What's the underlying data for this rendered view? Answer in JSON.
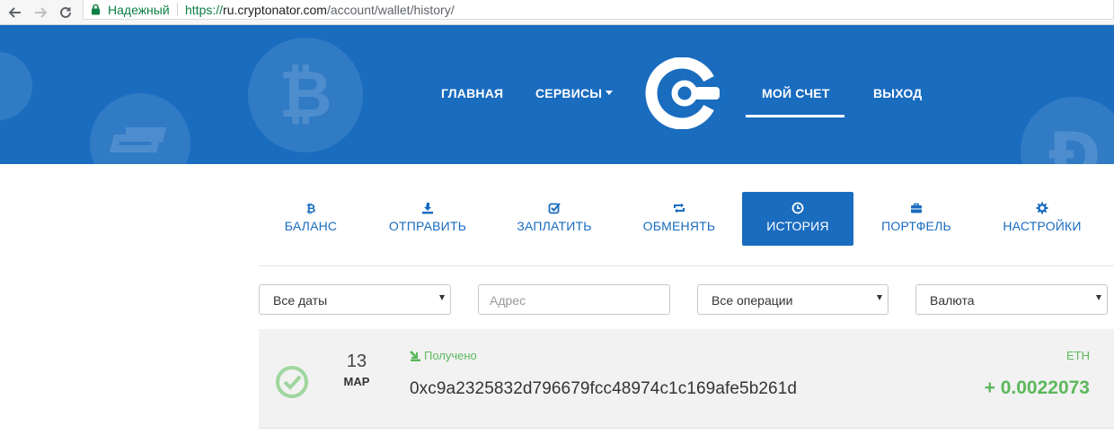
{
  "browser": {
    "secure_label": "Надежный",
    "url_scheme": "https://",
    "url_host": "ru.cryptonator.com",
    "url_path": "/account/wallet/history/"
  },
  "header": {
    "nav": [
      {
        "label": "ГЛАВНАЯ"
      },
      {
        "label": "СЕРВИСЫ"
      },
      {
        "label": "МОЙ СЧЕТ"
      },
      {
        "label": "ВЫХОД"
      }
    ],
    "active_nav": "МОЙ СЧЕТ",
    "colors": {
      "brand": "#1a6cbf",
      "text": "#ffffff"
    }
  },
  "tabs": [
    {
      "label": "БАЛАНС",
      "icon": "bitcoin-icon"
    },
    {
      "label": "ОТПРАВИТЬ",
      "icon": "send-icon"
    },
    {
      "label": "ЗАПЛАТИТЬ",
      "icon": "checkbox-icon"
    },
    {
      "label": "ОБМЕНЯТЬ",
      "icon": "exchange-icon"
    },
    {
      "label": "ИСТОРИЯ",
      "icon": "clock-icon"
    },
    {
      "label": "ПОРТФЕЛЬ",
      "icon": "briefcase-icon"
    },
    {
      "label": "НАСТРОЙКИ",
      "icon": "gear-icon"
    }
  ],
  "active_tab": "ИСТОРИЯ",
  "filters": {
    "dates": {
      "selected": "Все даты"
    },
    "address": {
      "placeholder": "Адрес"
    },
    "operations": {
      "selected": "Все операции"
    },
    "currency": {
      "selected": "Валюта"
    }
  },
  "transactions": [
    {
      "day": "13",
      "month": "МАР",
      "status": "Получено",
      "address": "0xc9a2325832d796679fcc48974c1c169afe5b261d",
      "currency": "ETH",
      "amount": "+ 0.0022073",
      "status_color": "#5cb85c"
    }
  ]
}
